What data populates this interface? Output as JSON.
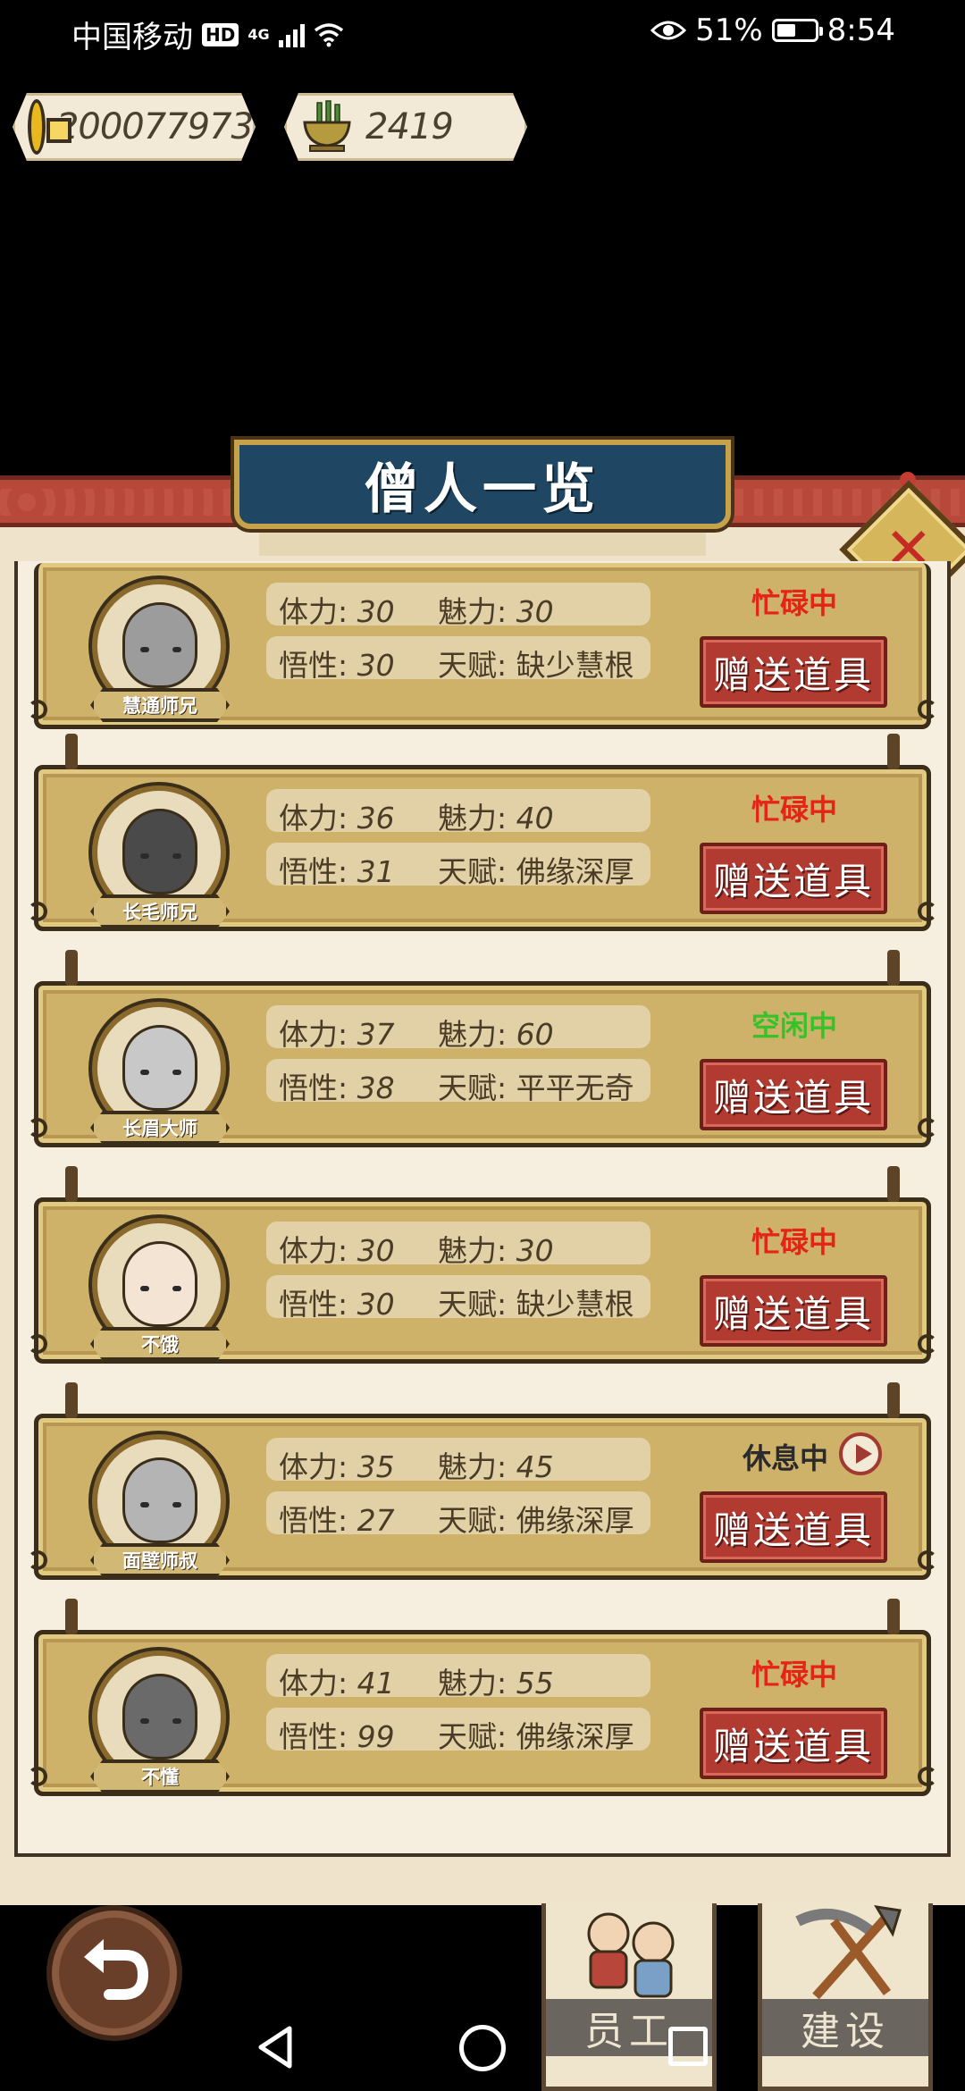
{
  "status_bar": {
    "carrier": "中国移动",
    "hd": "HD",
    "network": "4G",
    "battery_percent": "51%",
    "battery_level": 0.51,
    "time": "8:54"
  },
  "resources": {
    "coins": "200077973",
    "incense": "2419",
    "coin_icon": "coin-icon",
    "incense_icon": "censer-icon"
  },
  "panel": {
    "title": "僧人一览"
  },
  "labels": {
    "stamina": "体力:",
    "charm": "魅力:",
    "wisdom": "悟性:",
    "talent": "天赋:",
    "gift_button": "赠送道具"
  },
  "monks": [
    {
      "name": "慧通师兄",
      "status": "忙碌中",
      "status_type": "busy",
      "stamina": "30",
      "charm": "30",
      "wisdom": "30",
      "talent": "缺少慧根"
    },
    {
      "name": "长毛师兄",
      "status": "忙碌中",
      "status_type": "busy",
      "stamina": "36",
      "charm": "40",
      "wisdom": "31",
      "talent": "佛缘深厚"
    },
    {
      "name": "长眉大师",
      "status": "空闲中",
      "status_type": "idle",
      "stamina": "37",
      "charm": "60",
      "wisdom": "38",
      "talent": "平平无奇"
    },
    {
      "name": "不饿",
      "status": "忙碌中",
      "status_type": "busy",
      "stamina": "30",
      "charm": "30",
      "wisdom": "30",
      "talent": "缺少慧根"
    },
    {
      "name": "面壁师叔",
      "status": "休息中",
      "status_type": "rest",
      "stamina": "35",
      "charm": "45",
      "wisdom": "27",
      "talent": "佛缘深厚"
    },
    {
      "name": "不懂",
      "status": "忙碌中",
      "status_type": "busy",
      "stamina": "41",
      "charm": "55",
      "wisdom": "99",
      "talent": "佛缘深厚"
    }
  ],
  "bottom": {
    "staff_tab": "员工",
    "build_tab": "建设"
  },
  "colors": {
    "busy": "#e32416",
    "idle": "#38c22a",
    "rest": "#2b2b2b",
    "gift_button": "#b13b31",
    "title_plate": "#1f4763"
  }
}
